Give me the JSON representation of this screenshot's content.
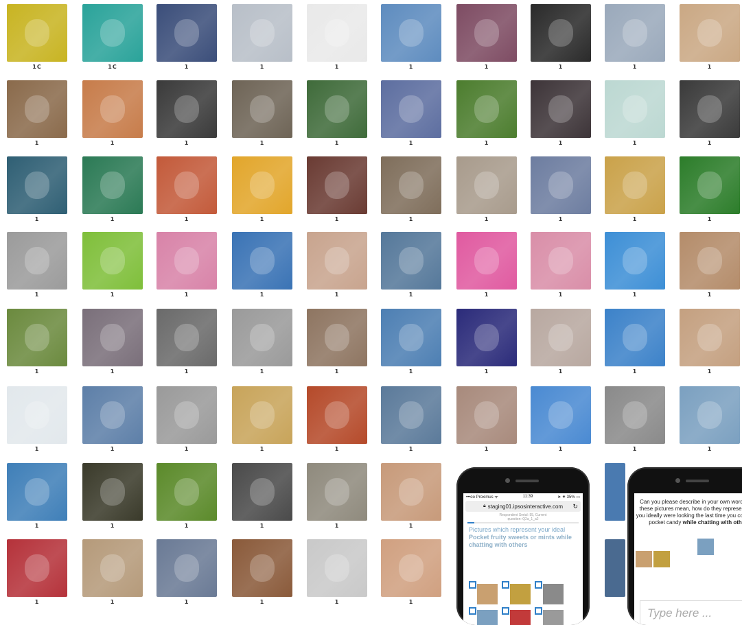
{
  "colors": {
    "phone_body": "#111111",
    "checkbox": "#2f7fc8",
    "question_text": "#7aa7c8"
  },
  "grid": {
    "rows": [
      {
        "numbers": [
          "1C",
          "1C",
          "1",
          "1",
          "1",
          "1",
          "1",
          "1",
          "1",
          "1"
        ],
        "colors": [
          "#c8b422",
          "#2aa39a",
          "#3b4e7a",
          "#b8bfc8",
          "#e9e9e9",
          "#5e8cbf",
          "#7e4c63",
          "#2a2a2a",
          "#9aa9bb",
          "#caa884"
        ]
      },
      {
        "numbers": [
          "1",
          "1",
          "1",
          "1",
          "1",
          "1",
          "1",
          "1",
          "1",
          "1"
        ],
        "colors": [
          "#8a6a4b",
          "#c77c4a",
          "#3a3a3a",
          "#6e6456",
          "#3f6b3a",
          "#5d6ea0",
          "#4c7d2e",
          "#3d3438",
          "#bcd8d2",
          "#3a3a3a"
        ]
      },
      {
        "numbers": [
          "1",
          "1",
          "1",
          "1",
          "1",
          "1",
          "1",
          "1",
          "1",
          "1"
        ],
        "colors": [
          "#2f5f74",
          "#2b7a55",
          "#c35a3a",
          "#e2a62b",
          "#6a3b33",
          "#7f6e5b",
          "#a89b8c",
          "#6d7da0",
          "#caa24a",
          "#2c7d2a"
        ]
      },
      {
        "numbers": [
          "1",
          "1",
          "1",
          "1",
          "1",
          "1",
          "1",
          "1",
          "1",
          "1"
        ],
        "colors": [
          "#9b9b9b",
          "#7fbf3a",
          "#d883a8",
          "#3a73b5",
          "#c8a48e",
          "#55789a",
          "#e05aa0",
          "#d98ea8",
          "#3d8fd6",
          "#b48c6a"
        ]
      },
      {
        "numbers": [
          "1",
          "1",
          "1",
          "1",
          "1",
          "1",
          "1",
          "1",
          "1",
          "1"
        ],
        "colors": [
          "#6b8a3e",
          "#7a6f7a",
          "#6a6a6a",
          "#9a9a9a",
          "#8e7561",
          "#4d7fb3",
          "#2b2b7a",
          "#b8a8a0",
          "#3c82c9",
          "#c4a080"
        ]
      },
      {
        "numbers": [
          "1",
          "1",
          "1",
          "1",
          "1",
          "1",
          "1",
          "1",
          "1",
          "1"
        ],
        "colors": [
          "#e2e8ec",
          "#5d7fa8",
          "#9a9a9a",
          "#c8a45a",
          "#b54a2a",
          "#5b7a9a",
          "#a88a7c",
          "#4a8ad2",
          "#8a8a8a",
          "#7ba0c0"
        ]
      },
      {
        "numbers": [
          "1",
          "1",
          "1",
          "1",
          "1",
          "1"
        ],
        "colors": [
          "#3f7fb8",
          "#3a3a2a",
          "#5b8a2a",
          "#4a4a4a",
          "#8f8a7d",
          "#c79a7a"
        ]
      },
      {
        "numbers": [
          "1",
          "1",
          "1",
          "1",
          "1",
          "1"
        ],
        "colors": [
          "#b5323a",
          "#b59a7a",
          "#6a7a95",
          "#8a5a3a",
          "#c9c9c9",
          "#d0a080"
        ]
      }
    ],
    "extra_partial": {
      "colors": [
        "#4a7ab0",
        "#4a6a90"
      ]
    }
  },
  "phone1": {
    "status": {
      "carrier": "•••oo Proximus ᯤ",
      "time": "11:39",
      "battery": "➤ ✷ 35% ▭"
    },
    "url": "staging01.ipsosinteractive.com",
    "subhead_line1": "Respondent Serial: 55, Current",
    "subhead_line2": "question: Q2a_1_a2",
    "question_plain": "Pictures which represent your ideal ",
    "question_bold": "Pocket fruity sweets or mints while chatting with others",
    "options": [
      "#c9a070",
      "#c2a040",
      "#8a8a8a",
      "#7ba0c0",
      "#c23a3a",
      "#9a9a9a"
    ]
  },
  "phone2": {
    "question_part1": "Can you please describe in your own words what these pictures mean, how do they represent what you ideally were looking the last time you consumed ",
    "question_mid": "pocket candy ",
    "question_bold": "while chatting with others",
    "thumbs": [
      "#c9a070",
      "#c2a040",
      "#7ba0c0"
    ],
    "type_placeholder": "Type here ..."
  }
}
